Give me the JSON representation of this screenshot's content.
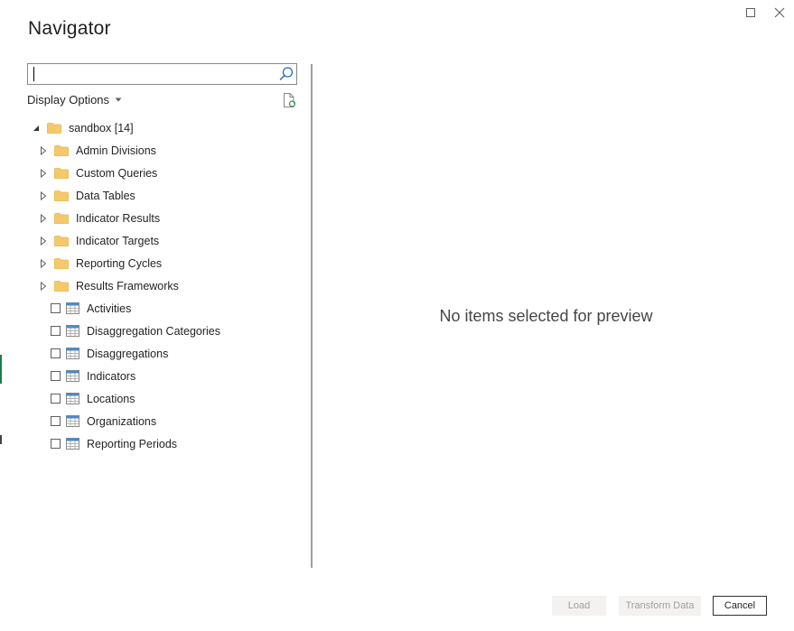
{
  "window": {
    "title": "Navigator"
  },
  "search": {
    "value": "",
    "placeholder": ""
  },
  "toolbar": {
    "display_options_label": "Display Options"
  },
  "tree": {
    "root": {
      "label": "sandbox [14]",
      "expanded": true
    },
    "folders": [
      {
        "label": "Admin Divisions"
      },
      {
        "label": "Custom Queries"
      },
      {
        "label": "Data Tables"
      },
      {
        "label": "Indicator Results"
      },
      {
        "label": "Indicator Targets"
      },
      {
        "label": "Reporting Cycles"
      },
      {
        "label": "Results Frameworks"
      }
    ],
    "tables": [
      {
        "label": "Activities",
        "checked": false
      },
      {
        "label": "Disaggregation Categories",
        "checked": false
      },
      {
        "label": "Disaggregations",
        "checked": false
      },
      {
        "label": "Indicators",
        "checked": false
      },
      {
        "label": "Locations",
        "checked": false
      },
      {
        "label": "Organizations",
        "checked": false
      },
      {
        "label": "Reporting Periods",
        "checked": false
      }
    ]
  },
  "preview": {
    "empty_message": "No items selected for preview"
  },
  "footer": {
    "load_label": "Load",
    "transform_label": "Transform Data",
    "cancel_label": "Cancel"
  },
  "colors": {
    "folder": "#f4c96b",
    "folder_dark": "#e8b548",
    "table_header": "#4a8ac9",
    "divider": "#a19f9d",
    "disabled_bg": "#f3f2f1",
    "disabled_text": "#a19f9d"
  }
}
